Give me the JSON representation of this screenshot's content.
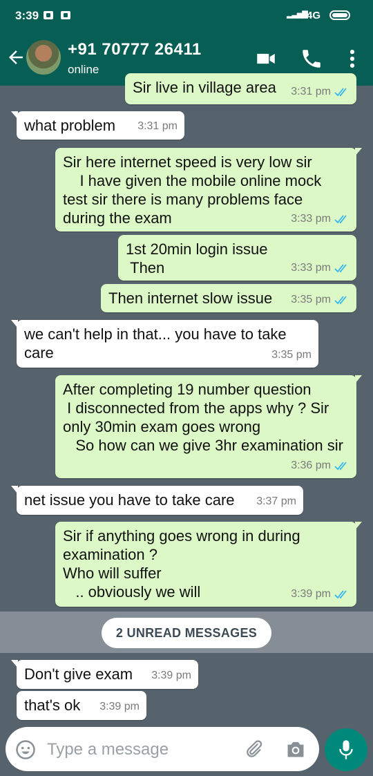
{
  "status_bar": {
    "time": "3:39",
    "network": "4G"
  },
  "header": {
    "contact_name": "+91 70777 26411",
    "contact_status": "online"
  },
  "messages": [
    {
      "dir": "out",
      "text": "Sir live in village area",
      "time": "3:31 pm",
      "read": true
    },
    {
      "dir": "in",
      "text": "what problem",
      "time": "3:31 pm"
    },
    {
      "dir": "out",
      "text": "Sir here internet speed is very low sir\n    I have given the mobile online mock test sir there is many problems face during the exam",
      "time": "3:33 pm",
      "read": true
    },
    {
      "dir": "out",
      "text": "1st 20min login issue\n Then",
      "time": "3:33 pm",
      "read": true
    },
    {
      "dir": "out",
      "text": "Then internet slow issue",
      "time": "3:35 pm",
      "read": true
    },
    {
      "dir": "in",
      "text": "we can't help in that... you have to take care",
      "time": "3:35 pm"
    },
    {
      "dir": "out",
      "text": "After completing 19 number question\n I disconnected from the apps why ? Sir only 30min exam goes wrong\n   So how can we give 3hr examination sir",
      "time": "3:36 pm",
      "read": true
    },
    {
      "dir": "in",
      "text": "net issue you have to take care",
      "time": "3:37 pm"
    },
    {
      "dir": "out",
      "text": "Sir if anything goes wrong in during examination ?\nWho will suffer\n   .. obviously we will",
      "time": "3:39 pm",
      "read": true
    },
    {
      "dir": "in",
      "text": "Don't give exam",
      "time": "3:39 pm"
    },
    {
      "dir": "in",
      "text": "that's ok",
      "time": "3:39 pm"
    }
  ],
  "unread_banner": "2 UNREAD MESSAGES",
  "composer": {
    "placeholder": "Type a message"
  },
  "colors": {
    "header": "#075e54",
    "outgoing_bubble": "#dcf8c6",
    "incoming_bubble": "#ffffff",
    "read_tick": "#34b7f1",
    "mic_button": "#00897b"
  }
}
